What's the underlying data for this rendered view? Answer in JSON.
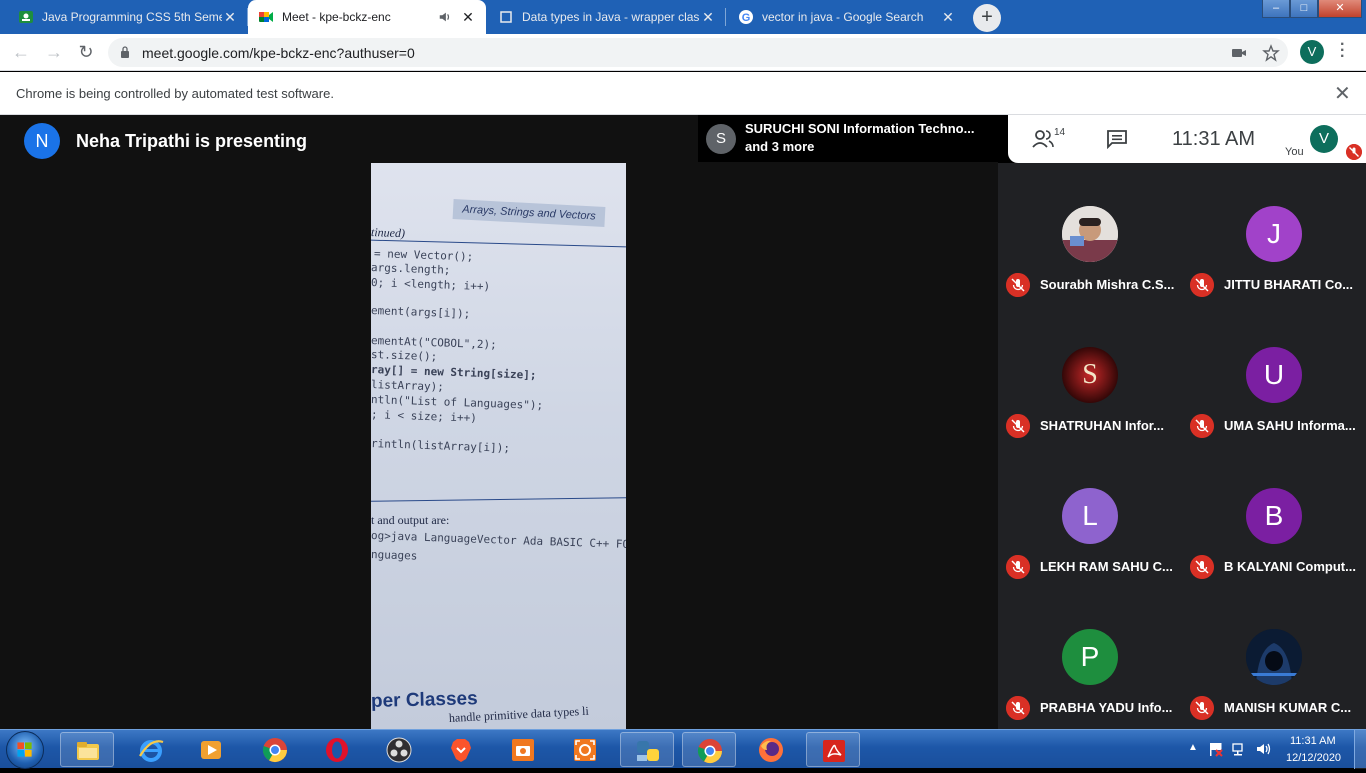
{
  "browser": {
    "tabs": [
      {
        "title": "Java Programming CSS 5th Seme",
        "active": false
      },
      {
        "title": "Meet - kpe-bckz-enc",
        "active": true
      },
      {
        "title": "Data types in Java - wrapper clas",
        "active": false
      },
      {
        "title": "vector in java - Google Search",
        "active": false
      }
    ],
    "new_tab_label": "+",
    "url": "meet.google.com/kpe-bckz-enc?authuser=0",
    "profile_initial": "V",
    "infobar_message": "Chrome is being controlled by automated test software."
  },
  "meet": {
    "presenter_initial": "N",
    "presenter_text": "Neha Tripathi is presenting",
    "joined": {
      "initial": "S",
      "line1": "SURUCHI SONI Information Techno...",
      "line2": "and 3 more"
    },
    "participant_count": "14",
    "time": "11:31  AM",
    "you_label": "You",
    "you_initial": "V",
    "participants": [
      {
        "name": "Sourabh Mishra C.S...",
        "initial": "",
        "color": "#9aa0a6",
        "photo": true
      },
      {
        "name": "JITTU BHARATI Co...",
        "initial": "J",
        "color": "#a142c9"
      },
      {
        "name": "SHATRUHAN Infor...",
        "initial": "S",
        "color": "#8b0f0f",
        "photo": true
      },
      {
        "name": "UMA SAHU Informa...",
        "initial": "U",
        "color": "#7b1fa2"
      },
      {
        "name": "LEKH RAM SAHU C...",
        "initial": "L",
        "color": "#8e63ce"
      },
      {
        "name": "B KALYANI Comput...",
        "initial": "B",
        "color": "#7b1fa2"
      },
      {
        "name": "PRABHA YADU Info...",
        "initial": "P",
        "color": "#1e8e3e"
      },
      {
        "name": "MANISH KUMAR C...",
        "initial": "",
        "color": "#0b1b33",
        "photo": true
      }
    ],
    "shared_doc": {
      "header": "Arrays, Strings and Vectors",
      "lines": [
        "tinued)",
        "= new Vector();",
        "args.length;",
        "0; i <length; i++)",
        "ement(args[i]);",
        "ementAt(\"COBOL\",2);",
        "st.size();",
        "ray[] = new String[size];",
        "listArray);",
        "ntln(\"List of Languages\");",
        "; i < size; i++)",
        "rintln(listArray[i]);",
        "t and output are:",
        "og>java LanguageVector Ada BASIC C++ FOR",
        "nguages",
        "per Classes",
        "handle primitive data types li"
      ]
    }
  },
  "taskbar": {
    "time": "11:31 AM",
    "date": "12/12/2020"
  }
}
